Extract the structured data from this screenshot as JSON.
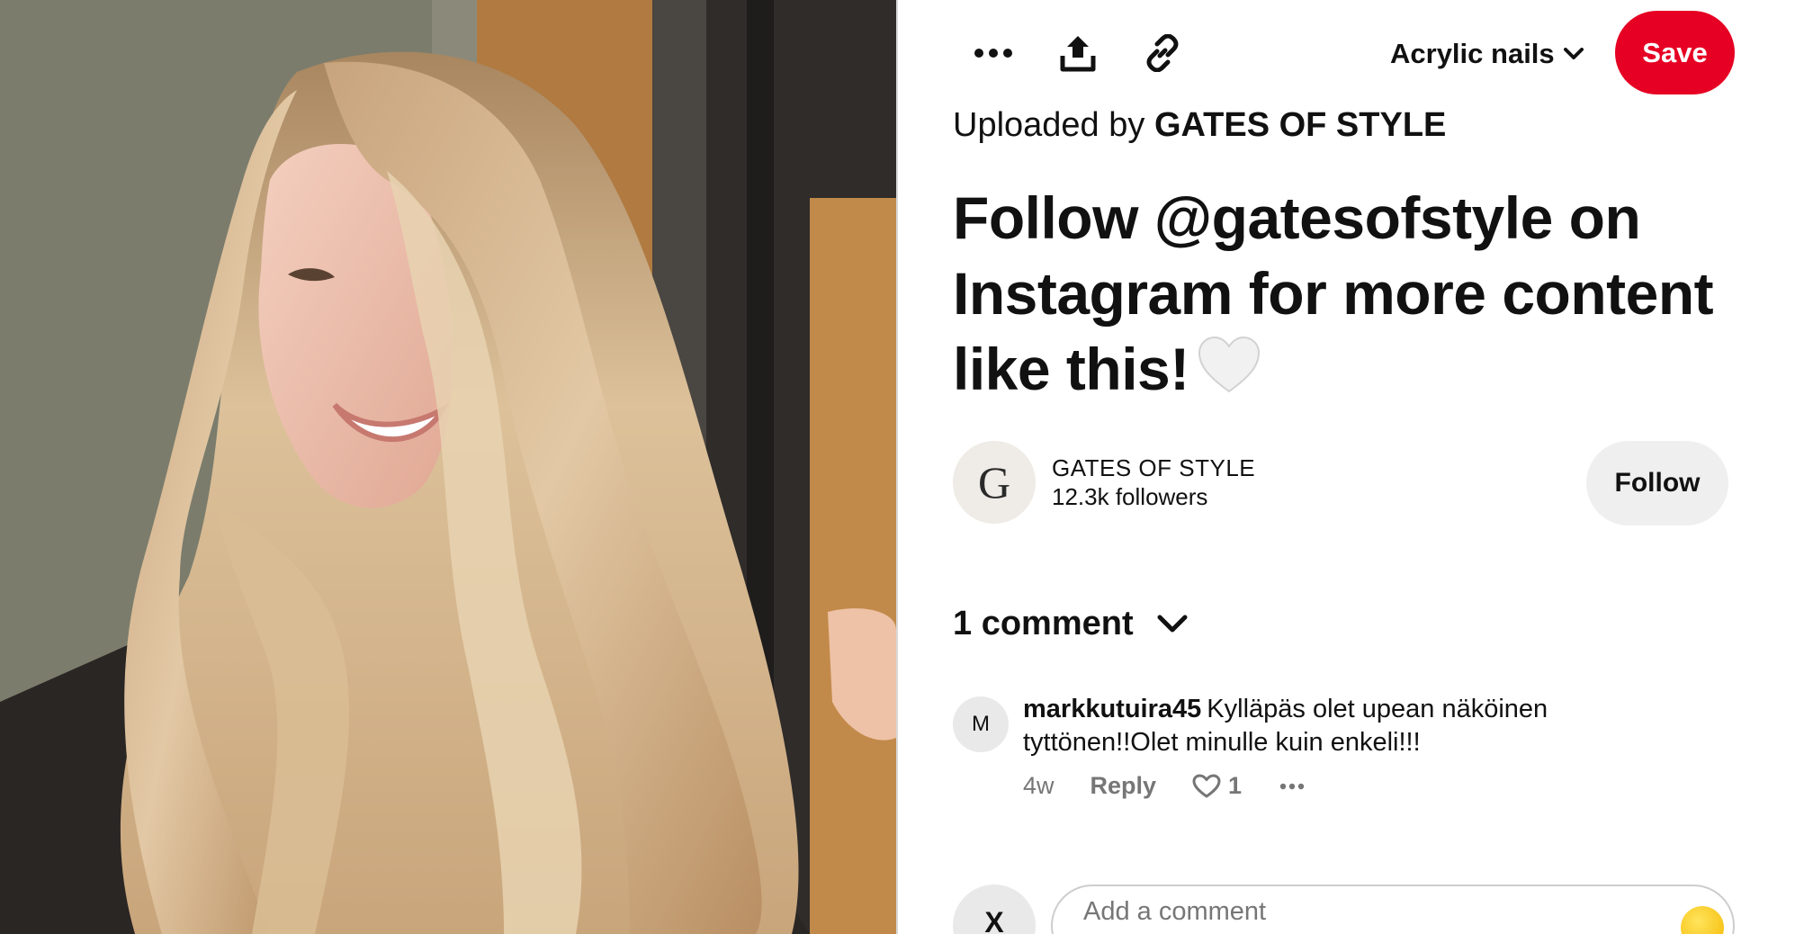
{
  "image": {
    "alt": "woman with long blonde layered hair smiling"
  },
  "toolbar": {
    "more_icon": "ellipsis-icon",
    "share_icon": "share-upload-icon",
    "link_icon": "link-icon",
    "board_name": "Acrylic nails",
    "save_label": "Save"
  },
  "pin": {
    "uploaded_prefix": "Uploaded by",
    "uploaded_source": "GATES OF STYLE",
    "title": "Follow @gatesofstyle on Instagram for more content like this!",
    "title_emoji": "white-heart-icon"
  },
  "creator": {
    "avatar_letter": "G",
    "name": "GATES OF STYLE",
    "followers": "12.3k followers",
    "follow_label": "Follow"
  },
  "comments": {
    "count_label": "1 comment",
    "items": [
      {
        "avatar_letter": "M",
        "author": "markkutuira45",
        "text": "Kylläpäs olet upean näköinen tyttönen!!Olet minulle kuin enkeli!!!",
        "time": "4w",
        "reply_label": "Reply",
        "likes": "1"
      }
    ]
  },
  "composer": {
    "avatar_letter": "X",
    "placeholder": "Add a comment"
  },
  "colors": {
    "save_red": "#e60023",
    "follow_gray": "#efefef",
    "meta_gray": "#767676"
  }
}
